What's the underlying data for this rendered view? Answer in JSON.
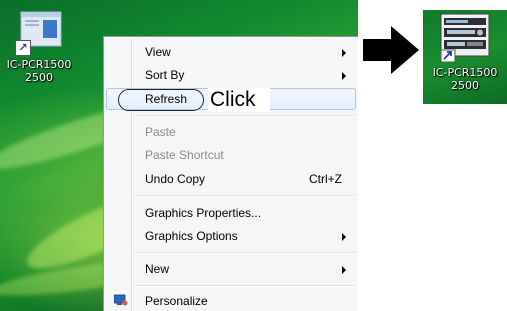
{
  "desktop": {
    "icon_label_line1": "IC-PCR1500",
    "icon_label_line2": "2500"
  },
  "context_menu": {
    "items": [
      {
        "label": "View",
        "submenu": true
      },
      {
        "label": "Sort By",
        "submenu": true
      },
      {
        "label": "Refresh",
        "highlighted": true
      },
      {
        "label": "Paste",
        "disabled": true
      },
      {
        "label": "Paste Shortcut",
        "disabled": true
      },
      {
        "label": "Undo Copy",
        "shortcut": "Ctrl+Z"
      },
      {
        "label": "Graphics Properties..."
      },
      {
        "label": "Graphics Options",
        "submenu": true
      },
      {
        "label": "New",
        "submenu": true
      },
      {
        "label": "Personalize",
        "icon": "personalize-icon"
      }
    ]
  },
  "annotation": {
    "click_text": "Click"
  },
  "result_icon": {
    "label_line1": "IC-PCR1500",
    "label_line2": "2500"
  },
  "colors": {
    "desktop_green": "#118a2f",
    "menu_bg": "#f5f6f7",
    "highlight_border": "#a8c8ec",
    "disabled_text": "#8a8a8a"
  }
}
